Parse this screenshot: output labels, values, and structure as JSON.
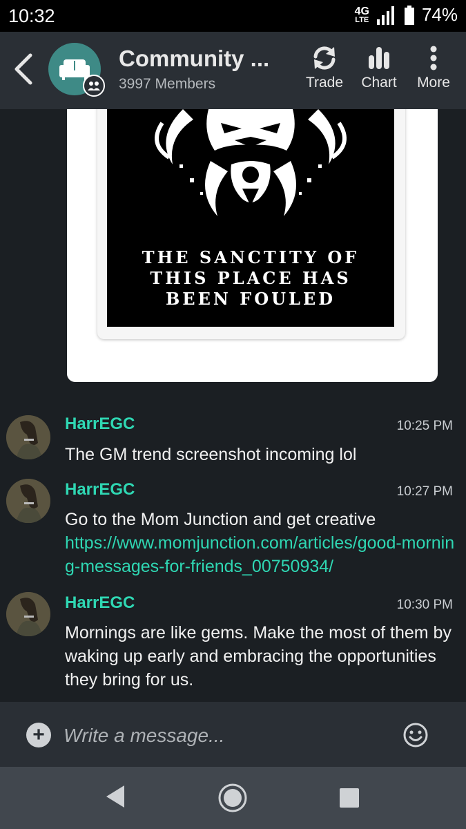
{
  "status_bar": {
    "time": "10:32",
    "network": "4G",
    "network_sub": "LTE",
    "battery": "74%"
  },
  "header": {
    "title": "Community ...",
    "members": "3997 Members",
    "actions": [
      {
        "label": "Trade",
        "icon": "refresh-icon"
      },
      {
        "label": "Chart",
        "icon": "bar-chart-icon"
      },
      {
        "label": "More",
        "icon": "more-vertical-icon"
      }
    ]
  },
  "image_post": {
    "caption_lines": [
      "THE SANCTITY OF",
      "THIS PLACE HAS",
      "BEEN FOULED"
    ]
  },
  "messages": [
    {
      "user": "HarrEGC",
      "time": "10:25 PM",
      "text": "The GM trend screenshot incoming lol"
    },
    {
      "user": "HarrEGC",
      "time": "10:27 PM",
      "text": "Go to the Mom Junction and get creative",
      "link": "https://www.momjunction.com/articles/good-morning-messages-for-friends_00750934/"
    },
    {
      "user": "HarrEGC",
      "time": "10:30 PM",
      "text": "Mornings are like gems. Make the most of them by waking up early and embracing the opportunities they bring for us."
    }
  ],
  "composer": {
    "placeholder": "Write a message..."
  },
  "colors": {
    "accent": "#2fd7b3",
    "header_bg": "#2a2f35",
    "chat_bg": "#1b1f23",
    "avatar_bg": "#3e8a86"
  }
}
